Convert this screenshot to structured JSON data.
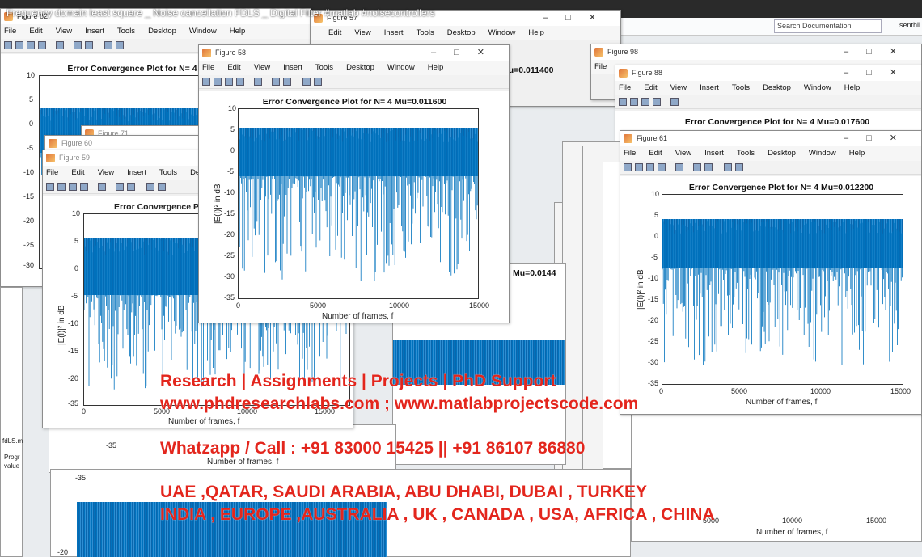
{
  "video_title": "Frequency domain least square _ Noise cancellation FDLS _ Digital Filter #matlab #noisecontrollers",
  "matlab_bar": {
    "search_placeholder": "Search Documentation",
    "user": "senthil"
  },
  "menu_items": [
    "File",
    "Edit",
    "View",
    "Insert",
    "Tools",
    "Desktop",
    "Window",
    "Help"
  ],
  "figures": {
    "f58": {
      "title": "Figure 58",
      "plot_title": "Error Convergence Plot for N= 4  Mu=0.011600",
      "xlabel": "Number of frames, f",
      "ylabel": "|E(l)|² in dB",
      "yticks": [
        "10",
        "5",
        "0",
        "-5",
        "-10",
        "-15",
        "-20",
        "-25",
        "-30",
        "-35"
      ],
      "xticks": [
        "0",
        "5000",
        "10000",
        "15000"
      ]
    },
    "f61": {
      "title": "Figure 61",
      "plot_title": "Error Convergence Plot for N= 4  Mu=0.012200",
      "xlabel": "Number of frames, f",
      "ylabel": "|E(l)|² in dB",
      "yticks": [
        "10",
        "5",
        "0",
        "-5",
        "-10",
        "-15",
        "-20",
        "-25",
        "-30",
        "-35"
      ],
      "xticks": [
        "0",
        "5000",
        "10000",
        "15000"
      ]
    },
    "f59": {
      "title": "Figure 59",
      "plot_title": "Error Convergence Pl",
      "xlabel": "Number of frames, f",
      "ylabel": "|E(l)|² in dB",
      "yticks": [
        "10",
        "5",
        "0",
        "-5",
        "-10",
        "-15",
        "-20",
        "-25",
        "-30",
        "-35"
      ],
      "xticks": [
        "0",
        "5000",
        "10000",
        "15000"
      ]
    },
    "f60": {
      "title": "Figure 60"
    },
    "f71": {
      "title": "Figure 71"
    },
    "f62": {
      "title": "Figure 62",
      "plot_title": "Error Convergence Plot for N= 4",
      "yticks": [
        "10",
        "5",
        "0",
        "-5",
        "-10",
        "-15",
        "-20",
        "-25",
        "-30"
      ]
    },
    "f57": {
      "title": "Figure 57",
      "mu_label": "Mu=0.011400"
    },
    "f98": {
      "title": "Figure 98"
    },
    "f88": {
      "title": "Figure 88",
      "plot_title": "Error Convergence Plot for N= 4  Mu=0.017600"
    },
    "f6x": {
      "title": "Figure 6"
    }
  },
  "mu_label_mid": "Mu=0.0144",
  "background_ticks": {
    "row1": [
      "0",
      "5000",
      "10000",
      "15000"
    ],
    "row2": [
      "0",
      "5000",
      "10000",
      "15000"
    ],
    "row3": [
      "5000",
      "10000",
      "15000"
    ],
    "neg35": "-35",
    "neg20": "-20",
    "xlabel": "Number of frames, f"
  },
  "side_panel": {
    "file": "fdLS.m",
    "prog": "Progr",
    "value": "value"
  },
  "overlay": {
    "line1": "Research | Assignments | Projects | PhD Support",
    "line2": "www.phdresearchlabs.com ; www.matlabprojectscode.com",
    "line3": "Whatzapp / Call : +91 83000 15425 || +91 86107 86880",
    "line4": "UAE ,QATAR, SAUDI ARABIA, ABU DHABI, DUBAI , TURKEY",
    "line5": "INDIA , EUROPE ,AUSTRALIA , UK , CANADA , USA, AFRICA , CHINA"
  },
  "colors": {
    "plot_blue": "#0072bd",
    "overlay_red": "#e3261d"
  }
}
